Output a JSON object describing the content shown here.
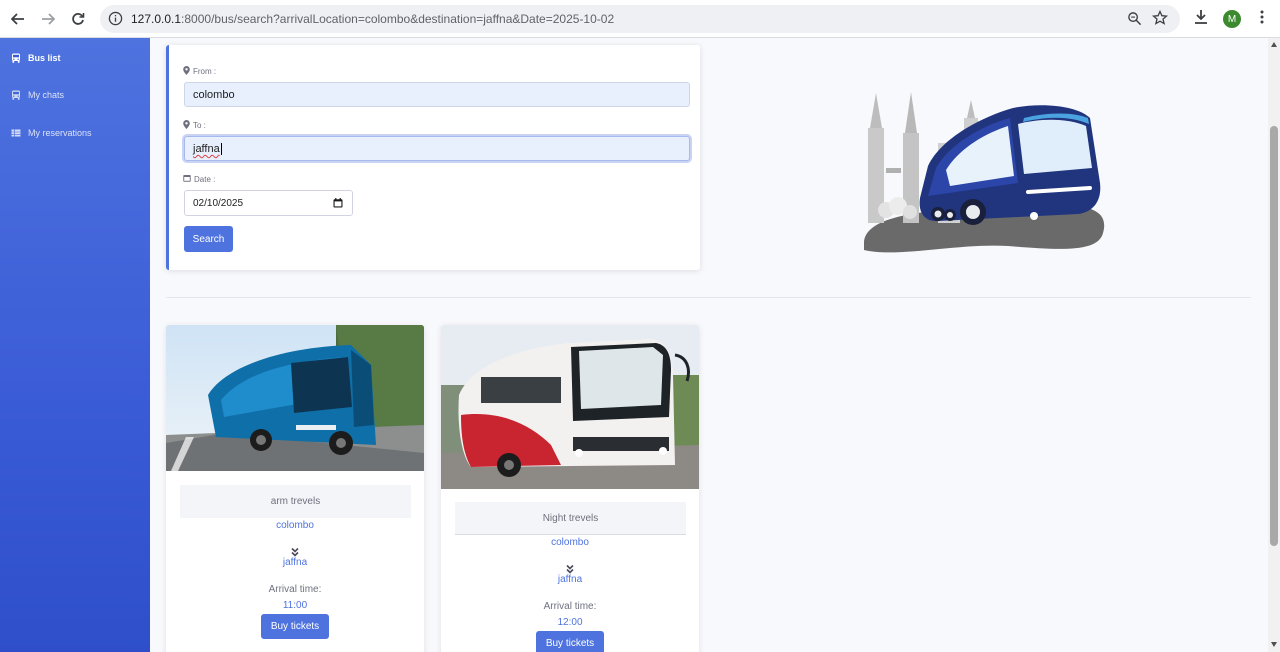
{
  "browser": {
    "url": "127.0.0.1:8000/bus/search?arrivalLocation=colombo&destination=jaffna&Date=2025-10-02",
    "url_host": "127.0.0.1",
    "url_rest": ":8000/bus/search?arrivalLocation=colombo&destination=jaffna&Date=2025-10-02",
    "avatar_letter": "M"
  },
  "sidebar": {
    "items": [
      {
        "label": "Bus list",
        "icon": "bus-icon",
        "active": true
      },
      {
        "label": "My chats",
        "icon": "bus-icon",
        "active": false
      },
      {
        "label": "My reservations",
        "icon": "table-icon",
        "active": false
      }
    ]
  },
  "search": {
    "from_label": "From :",
    "from_value": "colombo",
    "to_label": "To :",
    "to_value": "jaffna",
    "date_label": "Date :",
    "date_value": "02/10/2025",
    "button_label": "Search"
  },
  "buses": [
    {
      "name": "arm trevels",
      "from": "colombo",
      "to": "jaffna",
      "arrival_label": "Arrival time:",
      "arrival_time": "11:00",
      "buy_label": "Buy tickets"
    },
    {
      "name": "Night trevels",
      "from": "colombo",
      "to": "jaffna",
      "arrival_label": "Arrival time:",
      "arrival_time": "12:00",
      "buy_label": "Buy tickets"
    }
  ],
  "colors": {
    "primary": "#4e73df",
    "sidebar_top": "#4e73df",
    "page_bg": "#f8f9fc"
  }
}
